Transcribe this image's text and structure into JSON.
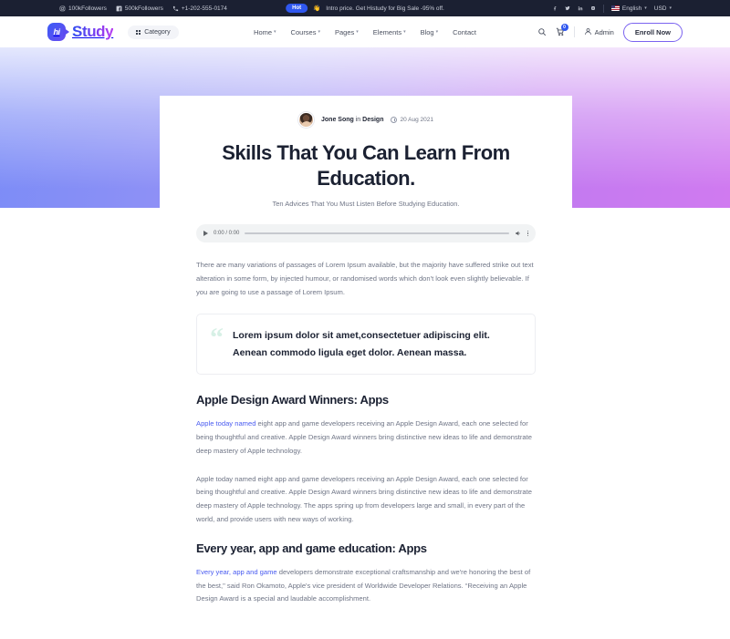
{
  "topbar": {
    "items": [
      {
        "icon": "instagram-icon",
        "label": "100kFollowers"
      },
      {
        "icon": "facebook-icon",
        "label": "500kFollowers"
      },
      {
        "icon": "phone-icon",
        "label": "+1-202-555-0174"
      }
    ],
    "promo": {
      "badge": "Hot",
      "emoji": "👋",
      "text": "Intro price. Get Histudy for Big Sale -95% off."
    },
    "socials": [
      "facebook-icon",
      "twitter-icon",
      "linkedin-icon",
      "instagram-icon"
    ],
    "language": "English",
    "currency": "USD"
  },
  "header": {
    "logo_mark": "hi",
    "logo_text": "Study",
    "category_label": "Category",
    "nav": [
      {
        "label": "Home",
        "has_dropdown": true
      },
      {
        "label": "Courses",
        "has_dropdown": true
      },
      {
        "label": "Pages",
        "has_dropdown": true
      },
      {
        "label": "Elements",
        "has_dropdown": true
      },
      {
        "label": "Blog",
        "has_dropdown": true
      },
      {
        "label": "Contact",
        "has_dropdown": false
      }
    ],
    "cart_count": "0",
    "account_label": "Admin",
    "enroll_label": "Enroll Now"
  },
  "post": {
    "author": "Jone Song",
    "author_in": "in",
    "category": "Design",
    "date": "20 Aug 2021",
    "title": "Skills That You Can Learn From Education.",
    "subtitle": "Ten Advices That You Must Listen Before Studying Education.",
    "audio": {
      "time": "0:00 / 0:00"
    },
    "intro": "There are many variations of passages of Lorem Ipsum available, but the majority have suffered strike out text alteration in some form, by injected humour, or randomised words which don't look even slightly believable. If you are going to use a passage of Lorem Ipsum.",
    "quote": "Lorem ipsum dolor sit amet,consectetuer adipiscing elit. Aenean commodo ligula eget dolor. Aenean massa.",
    "sections": [
      {
        "heading": "Apple Design Award Winners: Apps",
        "link": "Apple today named",
        "p1_rest": " eight app and game developers receiving an Apple Design Award, each one selected for being thoughtful and creative. Apple Design Award winners bring distinctive new ideas to life and demonstrate deep mastery of Apple technology.",
        "p2": "Apple today named eight app and game developers receiving an Apple Design Award, each one selected for being thoughtful and creative. Apple Design Award winners bring distinctive new ideas to life and demonstrate deep mastery of Apple technology. The apps spring up from developers large and small, in every part of the world, and provide users with new ways of working."
      },
      {
        "heading": "Every year, app and game education: Apps",
        "link": "Every year, app and game",
        "p1_rest": " developers demonstrate exceptional craftsmanship and we're honoring the best of the best,\" said Ron Okamoto, Apple's vice president of Worldwide Developer Relations. “Receiving an Apple Design Award is a special and laudable accomplishment."
      }
    ]
  },
  "colors": {
    "topbar_bg": "#1b2032",
    "accent_blue": "#2f57ef",
    "link": "#4a5cf0",
    "hero_from": "#7b8cf7",
    "hero_to": "#d07af0"
  }
}
